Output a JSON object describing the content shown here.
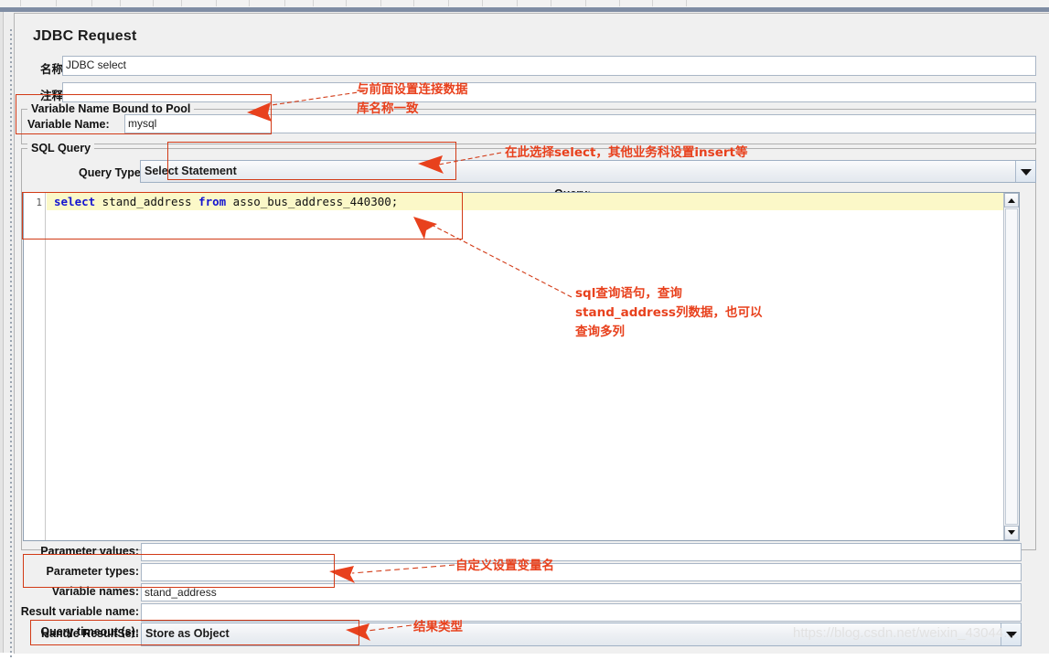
{
  "window": {
    "title": "JDBC Request"
  },
  "form": {
    "name_label": "名称:",
    "name_value": "JDBC select",
    "comment_label": "注释:",
    "comment_value": ""
  },
  "pool_group": {
    "title": "Variable Name Bound to Pool",
    "variable_name_label": "Variable Name:",
    "variable_name_value": "mysql"
  },
  "sql_group": {
    "title": "SQL Query",
    "query_type_label": "Query Type:",
    "query_type_value": "Select Statement",
    "query_caption": "Query:",
    "editor": {
      "line_number": "1",
      "code_tokens": [
        {
          "text": "select",
          "kind": "keyword"
        },
        {
          "text": " stand_address ",
          "kind": "plain"
        },
        {
          "text": "from",
          "kind": "keyword"
        },
        {
          "text": " asso_bus_address_440300;",
          "kind": "plain"
        }
      ],
      "code_plain": "select stand_address from asso_bus_address_440300;"
    }
  },
  "fields": [
    {
      "label": "Parameter values:",
      "value": "",
      "type": "text"
    },
    {
      "label": "Parameter types:",
      "value": "",
      "type": "text"
    },
    {
      "label": "Variable names:",
      "value": "stand_address",
      "type": "text"
    },
    {
      "label": "Result variable name:",
      "value": "",
      "type": "text"
    },
    {
      "label": "Query timeout (s):",
      "value": "",
      "type": "text"
    },
    {
      "label": "Handle ResultSet:",
      "value": "Store as Object",
      "type": "combo"
    }
  ],
  "annotations": [
    {
      "id": "pool-note",
      "text": "与前面设置连接数据\n库名称一致"
    },
    {
      "id": "query-type-note",
      "text": "在此选择select，其他业务科设置insert等"
    },
    {
      "id": "sql-note",
      "text": "sql查询语句，查询\nstand_address列数据，也可以\n查询多列"
    },
    {
      "id": "variable-names-note",
      "text": "自定义设置变量名"
    },
    {
      "id": "handle-resultset-note",
      "text": "结果类型"
    }
  ],
  "watermark": {
    "text": "https://blog.csdn.net/weixin_43044..."
  },
  "colors": {
    "annotation": "#e8411d",
    "panel_bg": "#f0f0f0",
    "title_bar": "#7f8da4",
    "code_keyword": "#1414d0",
    "code_line_highlight": "#fbf8c8"
  }
}
